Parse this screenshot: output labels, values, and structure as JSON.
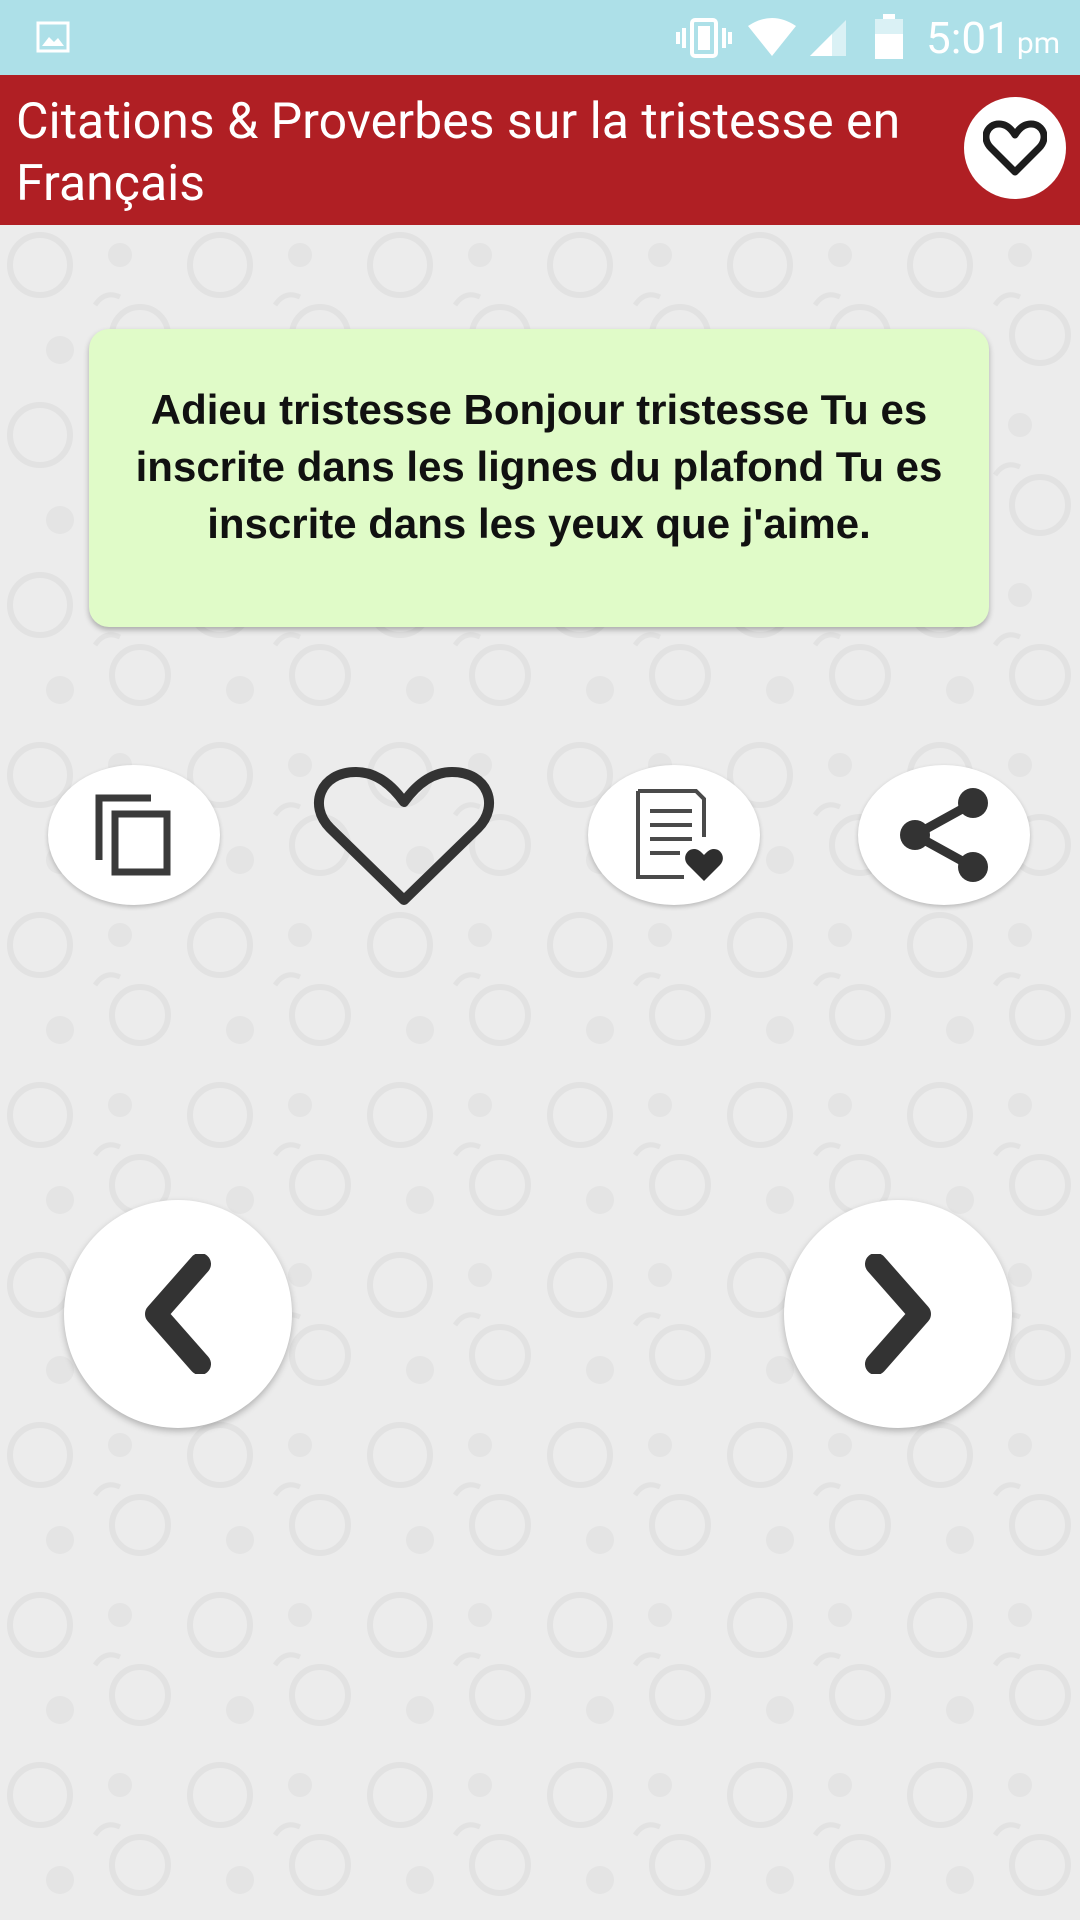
{
  "status_bar": {
    "time": "5:01",
    "ampm": "pm",
    "icons": [
      "gallery-icon",
      "vibrate-icon",
      "wifi-icon",
      "signal-icon",
      "battery-icon"
    ],
    "background_color": "#ade0e8"
  },
  "app_bar": {
    "title": "Citations & Proverbes sur la tristesse en Français",
    "background_color": "#b01f24",
    "favorites_icon": "heart-outline-icon"
  },
  "quote": {
    "text": "Adieu tristesse Bonjour tristesse Tu es inscrite dans les lignes du plafond Tu es inscrite dans les yeux que j'aime.",
    "background_color": "#e0fbc8"
  },
  "actions": [
    {
      "name": "copy",
      "icon": "copy-icon"
    },
    {
      "name": "like",
      "icon": "heart-outline-icon"
    },
    {
      "name": "favorites-list",
      "icon": "list-heart-icon"
    },
    {
      "name": "share",
      "icon": "share-icon"
    }
  ],
  "navigation": {
    "prev_icon": "chevron-left-icon",
    "next_icon": "chevron-right-icon"
  }
}
